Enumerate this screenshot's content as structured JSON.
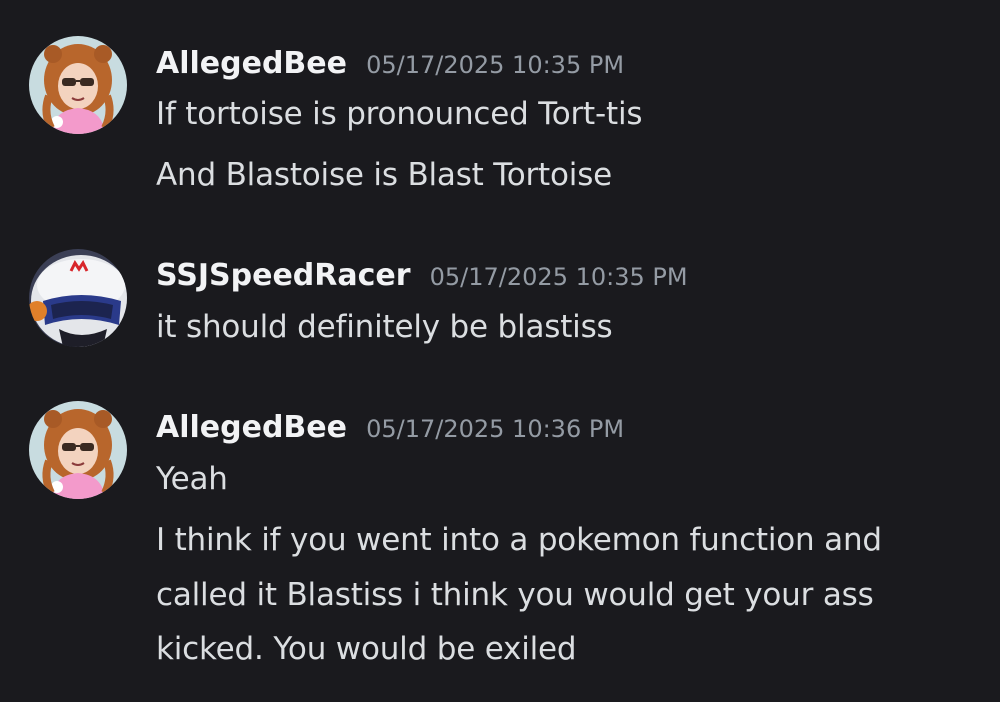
{
  "messages": [
    {
      "username": "AllegedBee",
      "timestamp": "05/17/2025 10:35 PM",
      "avatar": "allegedbee-avatar",
      "lines": [
        "If tortoise is pronounced Tort-tis",
        "And Blastoise is Blast Tortoise"
      ]
    },
    {
      "username": "SSJSpeedRacer",
      "timestamp": "05/17/2025 10:35 PM",
      "avatar": "speedracer-helmet-avatar",
      "lines": [
        "it should definitely be blastiss"
      ]
    },
    {
      "username": "AllegedBee",
      "timestamp": "05/17/2025 10:36 PM",
      "avatar": "allegedbee-avatar",
      "lines": [
        "Yeah",
        "I think if you went into a pokemon function and",
        "called it Blastiss i think you would get your ass",
        "kicked. You would be exiled"
      ]
    }
  ],
  "colors": {
    "background": "#1a1a1e",
    "username": "#f2f3f5",
    "timestamp": "#949ba4",
    "message_text": "#dbdee1"
  }
}
